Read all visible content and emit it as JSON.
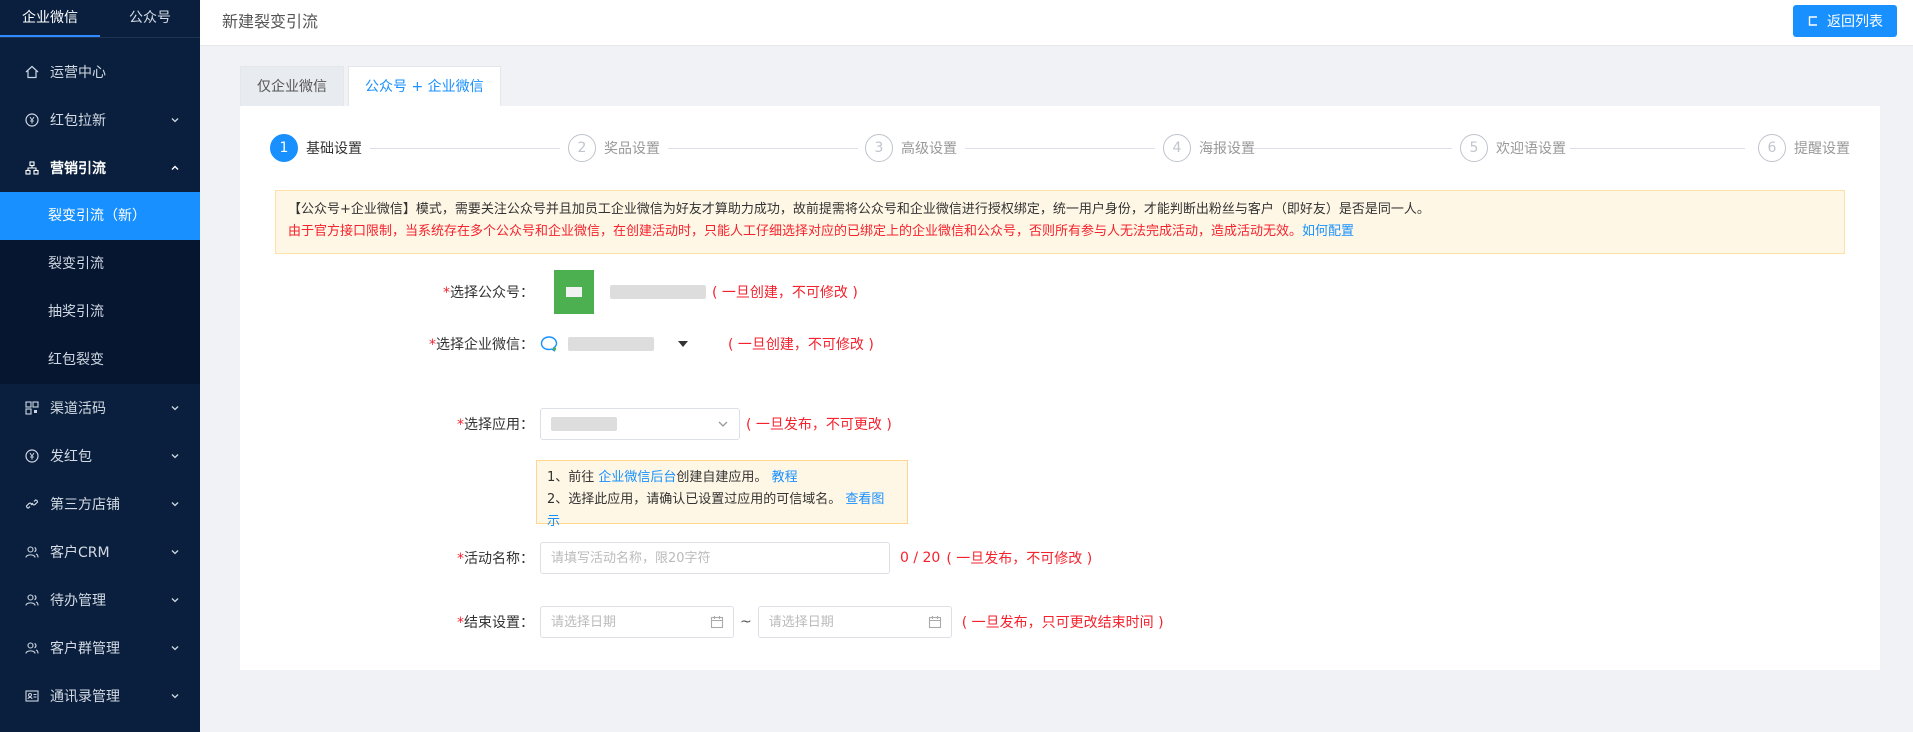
{
  "sidebar": {
    "tabs": [
      {
        "label": "企业微信"
      },
      {
        "label": "公众号"
      }
    ],
    "menu": [
      {
        "label": "运营中心",
        "icon": "home-icon"
      },
      {
        "label": "红包拉新",
        "icon": "yen-circle-icon"
      },
      {
        "label": "营销引流",
        "icon": "org-chart-icon"
      },
      {
        "label": "渠道活码",
        "icon": "qrcode-icon"
      },
      {
        "label": "发红包",
        "icon": "yen-circle-icon"
      },
      {
        "label": "第三方店铺",
        "icon": "link-icon"
      },
      {
        "label": "客户CRM",
        "icon": "users-icon"
      },
      {
        "label": "待办管理",
        "icon": "users-icon"
      },
      {
        "label": "客户群管理",
        "icon": "users-icon"
      },
      {
        "label": "通讯录管理",
        "icon": "contact-card-icon"
      }
    ],
    "submenu": [
      {
        "label": "裂变引流（新）"
      },
      {
        "label": "裂变引流"
      },
      {
        "label": "抽奖引流"
      },
      {
        "label": "红包裂变"
      }
    ]
  },
  "header": {
    "title": "新建裂变引流",
    "back_label": "返回列表"
  },
  "tabs": [
    {
      "label": "仅企业微信"
    },
    {
      "label": "公众号 + 企业微信"
    }
  ],
  "steps": [
    {
      "num": "1",
      "label": "基础设置"
    },
    {
      "num": "2",
      "label": "奖品设置"
    },
    {
      "num": "3",
      "label": "高级设置"
    },
    {
      "num": "4",
      "label": "海报设置"
    },
    {
      "num": "5",
      "label": "欢迎语设置"
    },
    {
      "num": "6",
      "label": "提醒设置"
    }
  ],
  "notice": {
    "line1": "【公众号+企业微信】模式，需要关注公众号并且加员工企业微信为好友才算助力成功，故前提需将公众号和企业微信进行授权绑定，统一用户身份，才能判断出粉丝与客户（即好友）是否是同一人。",
    "line2": "由于官方接口限制，当系统存在多个公众号和企业微信，在创建活动时，只能人工仔细选择对应的已绑定上的企业微信和公众号，否则所有参与人无法完成活动，造成活动无效。",
    "link": "如何配置"
  },
  "form": {
    "gzh_label": "选择公众号：",
    "gzh_hint": "( 一旦创建，不可修改 )",
    "qywx_label": "选择企业微信：",
    "qywx_hint": "( 一旦创建，不可修改 )",
    "app_label": "选择应用：",
    "app_hint": "( 一旦发布，不可更改 )",
    "tip1_prefix": "1、前往 ",
    "tip1_link": "企业微信后台",
    "tip1_suffix": "创建自建应用。 ",
    "tip1_link2": "教程",
    "tip2_text": "2、选择此应用，请确认已设置过应用的可信域名。 ",
    "tip2_link": "查看图示",
    "name_label": "活动名称：",
    "name_placeholder": "请填写活动名称，限20字符",
    "name_counter": "0 / 20",
    "name_hint": "( 一旦发布，不可修改 )",
    "end_label": "结束设置：",
    "start_placeholder": "请选择日期",
    "end_placeholder": "请选择日期",
    "tilde": "~",
    "end_hint": "( 一旦发布，只可更改结束时间 )",
    "required_mark": "*"
  },
  "colors": {
    "primary": "#1890ff",
    "sidebar_bg": "#0a1f3d",
    "danger": "#f5222d",
    "notice_bg": "#fff7e6"
  }
}
